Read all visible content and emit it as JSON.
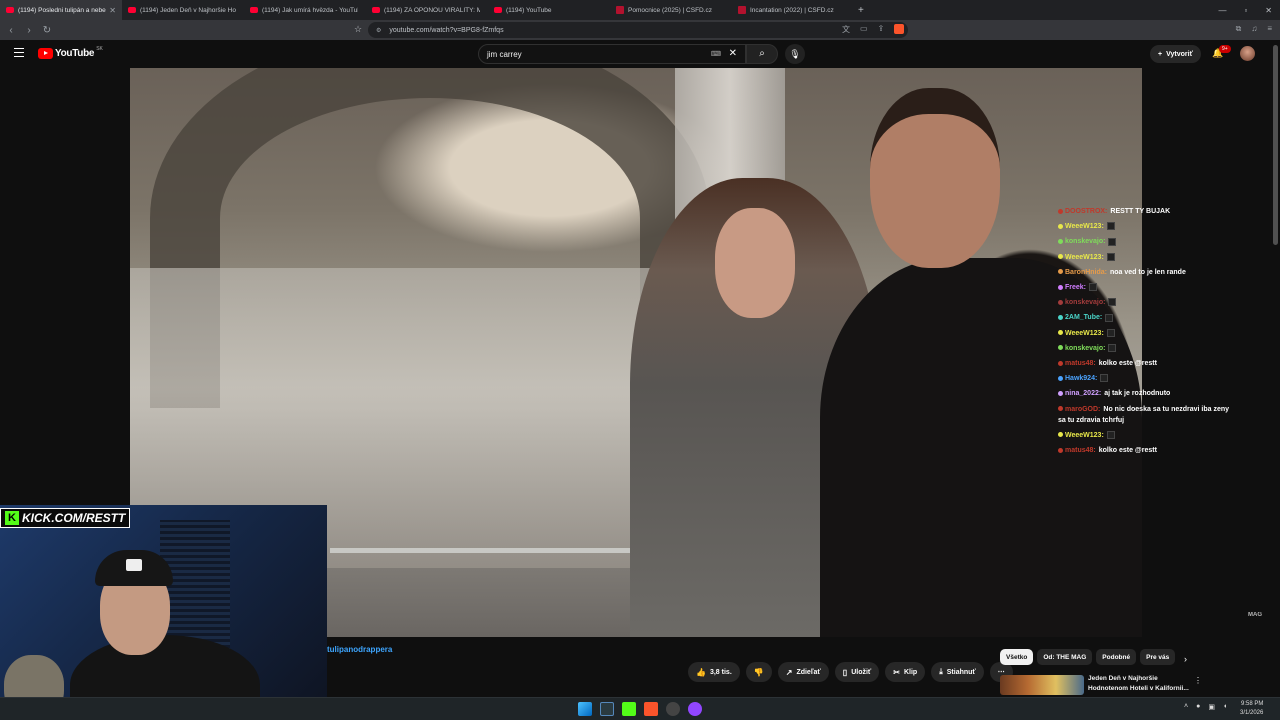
{
  "browser": {
    "tabs": [
      {
        "title": "(1194) Posledni tulipán a nebe",
        "active": true
      },
      {
        "title": "(1194) Jeden Deň v Najhoršie Hodnotenom Hoteli",
        "active": false
      },
      {
        "title": "(1194) Jak umírá hvězda - YouTube",
        "active": false
      },
      {
        "title": "(1194) ZA OPONOU VIRALITY: MELI",
        "active": false
      },
      {
        "title": "(1194) YouTube",
        "active": false
      },
      {
        "title": "Pomocnice (2025) | ČSFD.cz",
        "active": false
      },
      {
        "title": "Incantation (2022) | ČSFD.cz",
        "active": false
      }
    ],
    "url": "youtube.com/watch?v=BPG8-fZmfqs"
  },
  "youtube": {
    "logo_text": "YouTube",
    "country": "SK",
    "search_value": "jim carrey",
    "create_label": "Vytvoriť",
    "notification_count": "9+"
  },
  "video": {
    "watermark": "MAG"
  },
  "chat": [
    {
      "user": "DOOSTROX:",
      "msg": "RESTT TY BUJAK",
      "color": "#c0392b"
    },
    {
      "user": "WeeeW123:",
      "msg": "",
      "color": "#e8e84a"
    },
    {
      "user": "konskevajo:",
      "msg": "",
      "color": "#7fdc5a"
    },
    {
      "user": "WeeeW123:",
      "msg": "",
      "color": "#e8e84a"
    },
    {
      "user": "BaronHnida:",
      "msg": "noa ved to je len rande",
      "color": "#e69b4a"
    },
    {
      "user": "Freek:",
      "msg": "",
      "color": "#d07dff"
    },
    {
      "user": "konskevajo:",
      "msg": "",
      "color": "#a33c3c"
    },
    {
      "user": "2AM_Tube:",
      "msg": "",
      "color": "#4ad4c8"
    },
    {
      "user": "WeeeW123:",
      "msg": "",
      "color": "#e8e84a"
    },
    {
      "user": "konskevajo:",
      "msg": "",
      "color": "#7fdc5a"
    },
    {
      "user": "matus48:",
      "msg": "kolko este @restt",
      "color": "#c0392b"
    },
    {
      "user": "Hawk924:",
      "msg": "",
      "color": "#4aa3ff"
    },
    {
      "user": "nina_2022:",
      "msg": "aj tak je rozhodnuto",
      "color": "#d0a0ff"
    },
    {
      "user": "maroGOD:",
      "msg": "No nic doeska sa tu nezdravi iba zeny sa tu zdravia tchrfuj",
      "color": "#c0392b"
    },
    {
      "user": "WeeeW123:",
      "msg": "",
      "color": "#e8e84a"
    },
    {
      "user": "matus48:",
      "msg": "kolko este @restt",
      "color": "#c0392b"
    }
  ],
  "stream": {
    "kick_text": "KICK.COM/RESTT"
  },
  "below": {
    "channel_text": "tulipanodrappera",
    "actions": [
      {
        "label": "3,8 tis.",
        "icon": "thumbs-up-icon",
        "glyph": "👍"
      },
      {
        "label": "",
        "icon": "thumbs-down-icon",
        "glyph": "👎"
      },
      {
        "label": "Zdieľať",
        "icon": "share-icon",
        "glyph": "↗"
      },
      {
        "label": "Uložiť",
        "icon": "save-icon",
        "glyph": "▯"
      },
      {
        "label": "Klip",
        "icon": "scissors-icon",
        "glyph": "✂"
      },
      {
        "label": "Stiahnuť",
        "icon": "download-icon",
        "glyph": "⤓"
      },
      {
        "label": "⋯",
        "icon": "more-icon",
        "glyph": ""
      }
    ],
    "chips": [
      "Všetko",
      "Od: THE MAG",
      "Podobné",
      "Pre vás"
    ],
    "recommended_title": "Jeden Deň v Najhoršie Hodnotenom Hoteli v Kalifornii..."
  },
  "taskbar": {
    "time": "9:58 PM",
    "date": "3/1/2026"
  }
}
